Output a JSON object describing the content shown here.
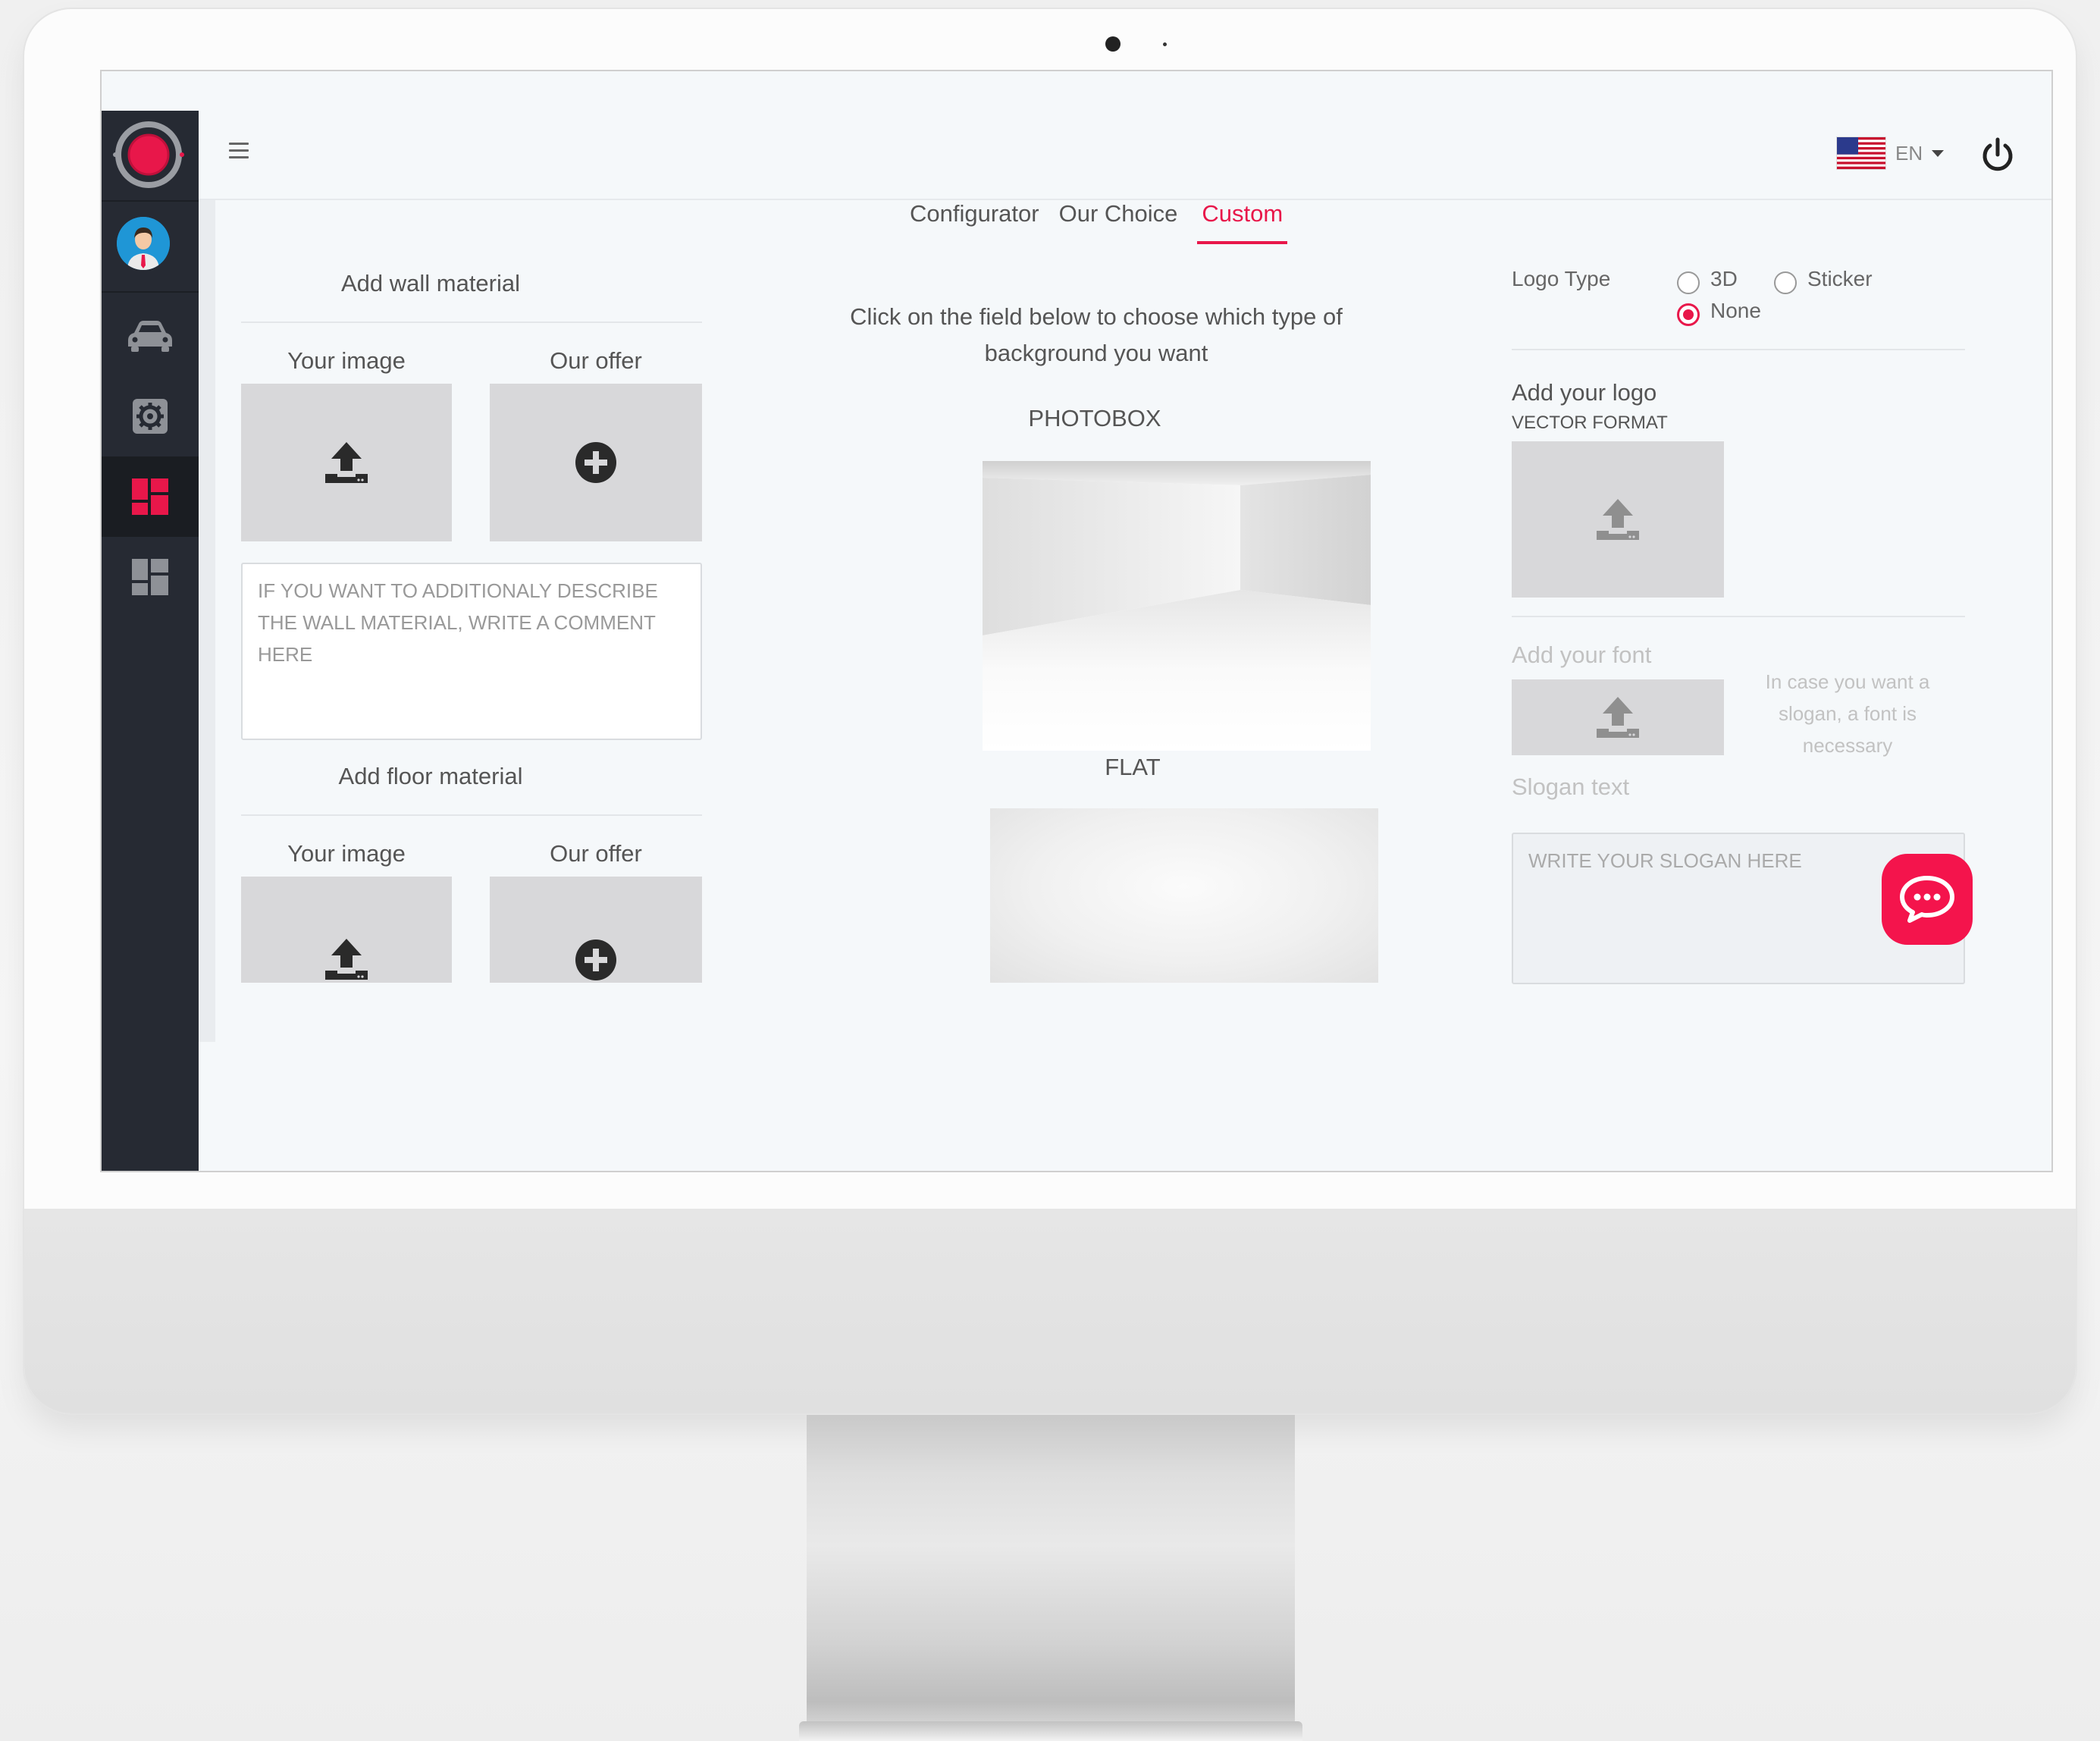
{
  "language": {
    "code": "EN"
  },
  "tabs": [
    {
      "label": "Configurator"
    },
    {
      "label": "Our Choice"
    },
    {
      "label": "Custom"
    }
  ],
  "wall": {
    "title": "Add wall material",
    "your_image": "Your image",
    "our_offer": "Our offer",
    "comment_placeholder": "IF YOU WANT TO ADDITIONALY DESCRIBE THE WALL MATERIAL, WRITE A COMMENT HERE"
  },
  "floor": {
    "title": "Add floor material",
    "your_image": "Your image",
    "our_offer": "Our offer"
  },
  "background": {
    "instruction": "Click on the field below to choose which type of background you want",
    "options": [
      {
        "label": "PHOTOBOX"
      },
      {
        "label": "FLAT"
      }
    ]
  },
  "logo": {
    "type_label": "Logo Type",
    "types": [
      {
        "label": "3D",
        "checked": false
      },
      {
        "label": "Sticker",
        "checked": false
      },
      {
        "label": "None",
        "checked": true
      }
    ],
    "add_logo": "Add your logo",
    "format": "VECTOR FORMAT",
    "add_font": "Add your font",
    "font_hint": "In case you want a slogan, a font is necessary",
    "slogan_label": "Slogan text",
    "slogan_placeholder": "WRITE YOUR SLOGAN HERE"
  },
  "icons": {
    "sidebar": [
      "app-logo-icon",
      "avatar",
      "car-icon",
      "settings-icon",
      "dashboard-icon",
      "layout-icon"
    ],
    "tiles": [
      "upload-icon",
      "plus-circle-icon"
    ],
    "header": [
      "hamburger-icon",
      "us-flag-icon",
      "power-icon"
    ],
    "chat": "chat-icon"
  },
  "colors": {
    "accent": "#e8174a",
    "sidebar": "#262a33",
    "tile": "#d8d8da"
  }
}
